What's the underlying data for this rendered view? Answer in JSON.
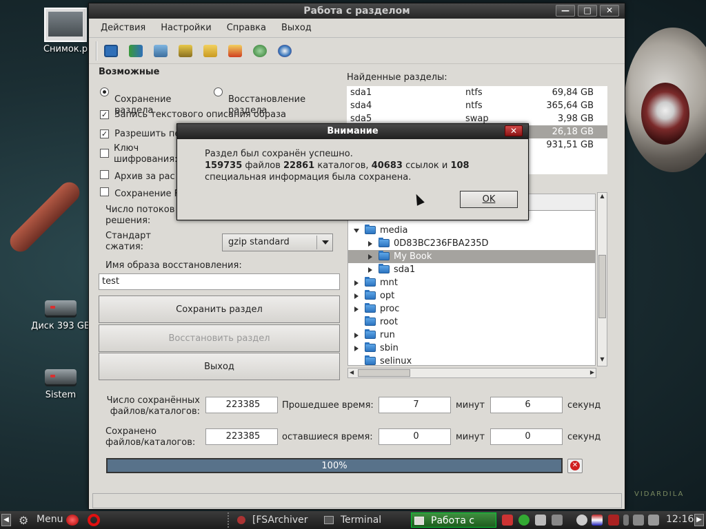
{
  "desktop": {
    "icons": [
      {
        "label": "Снимок.p"
      },
      {
        "label": "Диск 393 GB"
      },
      {
        "label": "Sistem"
      }
    ],
    "watermark": "VIDARDILA"
  },
  "window": {
    "title": "Работа с разделом",
    "controls": {
      "minimize": "—",
      "maximize": "□",
      "close": "✕"
    },
    "menu": [
      "Действия",
      "Настройки",
      "Справка",
      "Выход"
    ],
    "toolbar_icons": [
      "save-icon",
      "restore-icon",
      "archive-icon",
      "warning-icon",
      "folder-forward-icon",
      "folder-delete-icon",
      "globe-icon",
      "help-icon"
    ],
    "options": {
      "title": "Возможные",
      "radio_save_line1": "Сохранение",
      "radio_save_line2": "раздела",
      "radio_restore_line1": "Восстановление",
      "radio_restore_line2": "раздела",
      "check_text_desc": "Запись текстового описания образа",
      "check_allow": "Разрешить пе",
      "check_key_line1": "Ключ",
      "check_key_line2": "шифрования:",
      "check_archive": "Архив за рас",
      "check_save": "Сохранение F"
    },
    "threads_label_line1": "Число потоков",
    "threads_label_line2": "решения:",
    "compression_label_line1": "Стандарт",
    "compression_label_line2": "сжатия:",
    "compression_value": "gzip standard",
    "image_name_label": "Имя образа восстановления:",
    "image_name_value": "test",
    "buttons": {
      "save": "Сохранить раздел",
      "restore": "Восстановить раздел",
      "exit": "Выход"
    },
    "found_label": "Найденные разделы:",
    "partitions": [
      {
        "name": "sda1",
        "fs": "ntfs",
        "size": "69,84 GB"
      },
      {
        "name": "sda4",
        "fs": "ntfs",
        "size": "365,64 GB"
      },
      {
        "name": "sda5",
        "fs": "swap",
        "size": "3,98 GB"
      },
      {
        "name": "",
        "fs": "",
        "size": "26,18 GB"
      },
      {
        "name": "",
        "fs": "",
        "size": "931,51 GB"
      }
    ],
    "tree": [
      {
        "label": "media",
        "level": 0,
        "open": true
      },
      {
        "label": "0D83BC236FBA235D",
        "level": 1
      },
      {
        "label": "My Book",
        "level": 1,
        "selected": true
      },
      {
        "label": "sda1",
        "level": 1
      },
      {
        "label": "mnt",
        "level": 0
      },
      {
        "label": "opt",
        "level": 0
      },
      {
        "label": "proc",
        "level": 0
      },
      {
        "label": "root",
        "level": 0,
        "leaf": true
      },
      {
        "label": "run",
        "level": 0
      },
      {
        "label": "sbin",
        "level": 0
      },
      {
        "label": "selinux",
        "level": 0,
        "leaf": true
      }
    ],
    "stats": {
      "saved_label_line1": "Число сохранённых",
      "saved_label_line2": "файлов/каталогов:",
      "saved_value": "223385",
      "elapsed_label": "Прошедшее время:",
      "elapsed_minutes": "7",
      "minutes_label": "минут",
      "elapsed_seconds": "6",
      "seconds_label": "секунд",
      "stored_label_line1": "Сохранено",
      "stored_label_line2": "файлов/каталогов:",
      "stored_value": "223385",
      "remaining_label": "оставшиеся время:",
      "remaining_minutes": "0",
      "remaining_seconds": "0"
    },
    "progress": {
      "percent": 100,
      "label": "100%"
    }
  },
  "dialog": {
    "title": "Внимание",
    "line1": "Раздел был сохранён успешно.",
    "files": "159735",
    "files_label": " файлов ",
    "dirs": "22861",
    "dirs_label": " каталогов, ",
    "links": "40683",
    "links_label": " ссылок и ",
    "special": "108",
    "line3": "специальная информация была сохранена.",
    "ok": "OK"
  },
  "taskbar": {
    "menu": "Menu",
    "items": [
      "[FSArchiver ...",
      "Terminal",
      "Работа с ра..."
    ],
    "clock": "12:16"
  }
}
